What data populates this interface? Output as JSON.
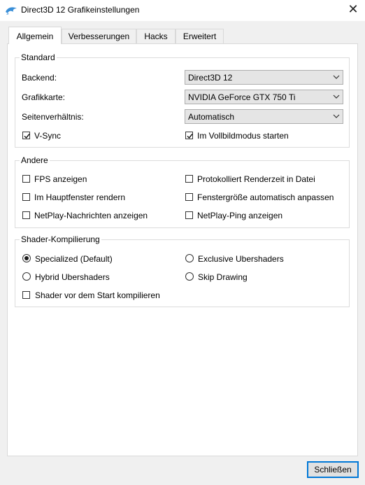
{
  "window": {
    "title": "Direct3D 12 Grafikeinstellungen",
    "close_glyph": "✕",
    "icon": "dolphin-icon"
  },
  "tabs": [
    {
      "label": "Allgemein",
      "active": true
    },
    {
      "label": "Verbesserungen",
      "active": false
    },
    {
      "label": "Hacks",
      "active": false
    },
    {
      "label": "Erweitert",
      "active": false
    }
  ],
  "standard": {
    "legend": "Standard",
    "backend": {
      "label": "Backend:",
      "value": "Direct3D 12"
    },
    "adapter": {
      "label": "Grafikkarte:",
      "value": "NVIDIA GeForce GTX 750 Ti"
    },
    "aspect": {
      "label": "Seitenverhältnis:",
      "value": "Automatisch"
    },
    "vsync": {
      "label": "V-Sync",
      "checked": true
    },
    "fullscreen": {
      "label": "Im Vollbildmodus starten",
      "checked": true
    }
  },
  "other": {
    "legend": "Andere",
    "fps": {
      "label": "FPS anzeigen",
      "checked": false
    },
    "log_render_time": {
      "label": "Protokolliert Renderzeit in Datei",
      "checked": false
    },
    "render_main": {
      "label": "Im Hauptfenster rendern",
      "checked": false
    },
    "auto_resize": {
      "label": "Fenstergröße automatisch anpassen",
      "checked": false
    },
    "netplay_msgs": {
      "label": "NetPlay-Nachrichten anzeigen",
      "checked": false
    },
    "netplay_ping": {
      "label": "NetPlay-Ping anzeigen",
      "checked": false
    }
  },
  "shader": {
    "legend": "Shader-Kompilierung",
    "specialized": {
      "label": "Specialized (Default)",
      "selected": true
    },
    "exclusive": {
      "label": "Exclusive Ubershaders",
      "selected": false
    },
    "hybrid": {
      "label": "Hybrid Ubershaders",
      "selected": false
    },
    "skip": {
      "label": "Skip Drawing",
      "selected": false
    },
    "precompile": {
      "label": "Shader vor dem Start kompilieren",
      "checked": false
    }
  },
  "footer": {
    "close_label": "Schließen"
  },
  "colors": {
    "accent": "#0078d7",
    "panel": "#ffffff",
    "window_bg": "#f0f0f0"
  }
}
